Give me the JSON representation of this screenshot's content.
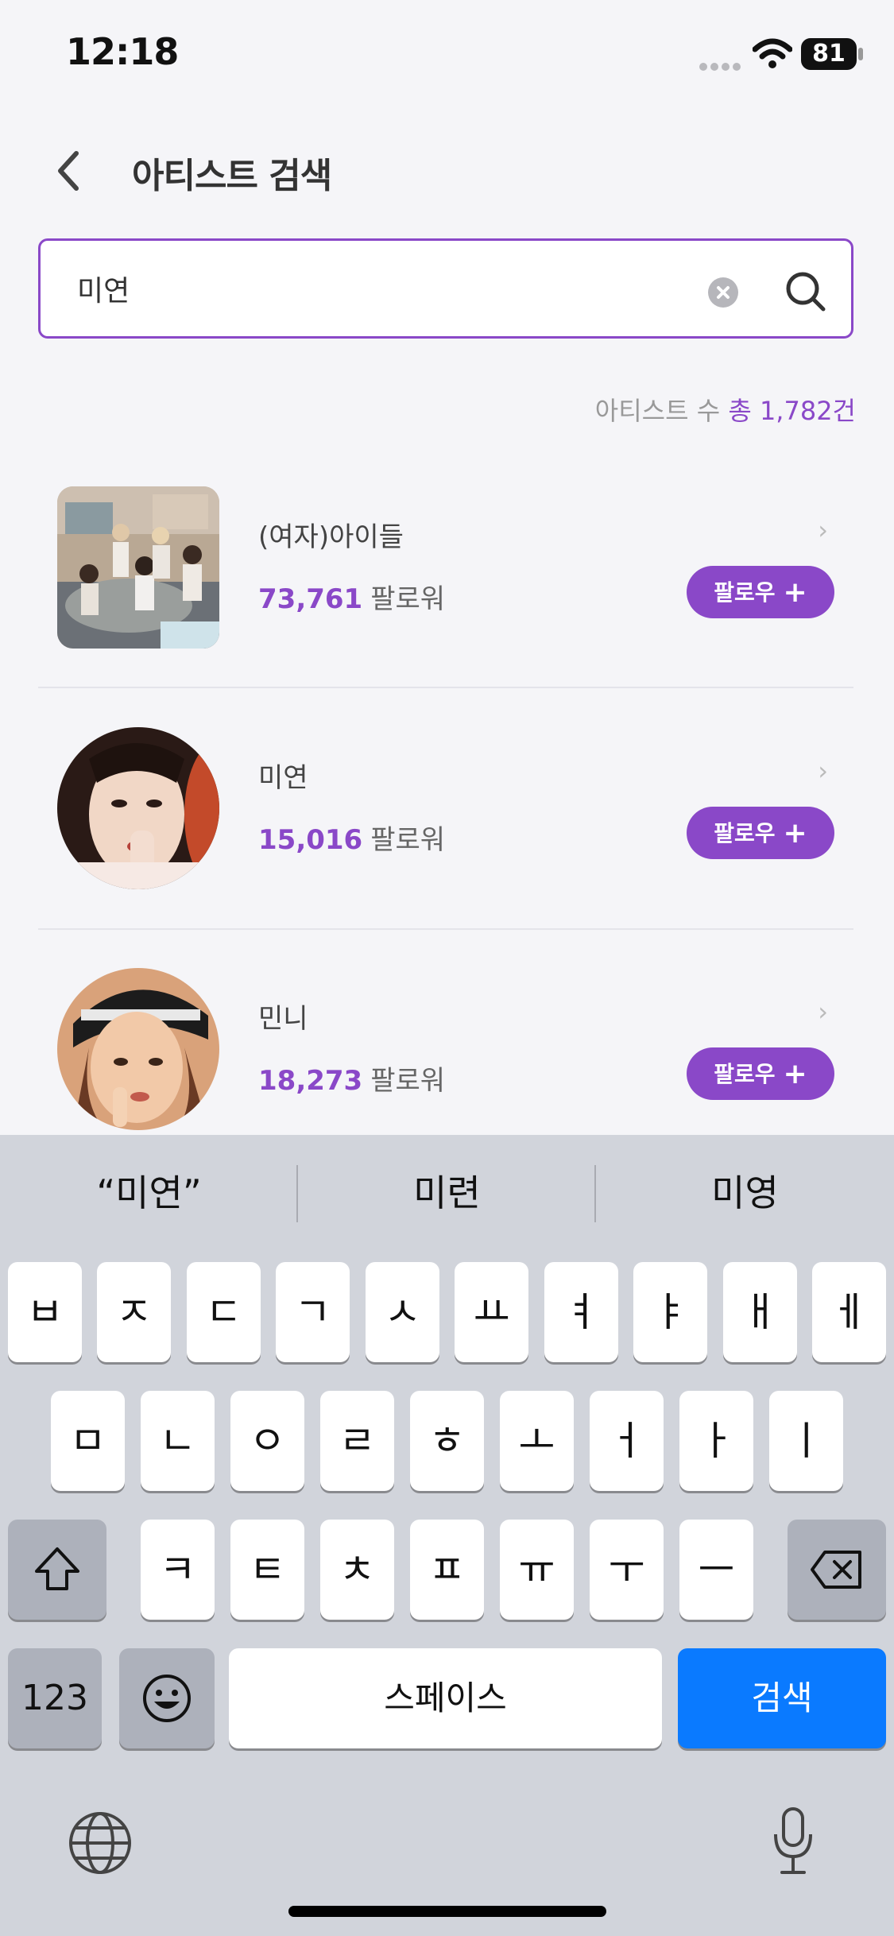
{
  "status_bar": {
    "time": "12:18",
    "battery": "81"
  },
  "header": {
    "title": "아티스트 검색"
  },
  "search": {
    "value": "미연",
    "placeholder": ""
  },
  "result_count": {
    "prefix": "아티스트 수",
    "total_label": "총 1,782건"
  },
  "results": [
    {
      "name": "(여자)아이들",
      "followers": "73,761",
      "followers_label": "팔로워",
      "follow_label": "팔로우"
    },
    {
      "name": "미연",
      "followers": "15,016",
      "followers_label": "팔로워",
      "follow_label": "팔로우"
    },
    {
      "name": "민니",
      "followers": "18,273",
      "followers_label": "팔로워",
      "follow_label": "팔로우"
    }
  ],
  "keyboard": {
    "suggestions": [
      "“미연”",
      "미련",
      "미영"
    ],
    "row1": [
      "ㅂ",
      "ㅈ",
      "ㄷ",
      "ㄱ",
      "ㅅ",
      "ㅛ",
      "ㅕ",
      "ㅑ",
      "ㅐ",
      "ㅔ"
    ],
    "row2": [
      "ㅁ",
      "ㄴ",
      "ㅇ",
      "ㄹ",
      "ㅎ",
      "ㅗ",
      "ㅓ",
      "ㅏ",
      "ㅣ"
    ],
    "row3": [
      "ㅋ",
      "ㅌ",
      "ㅊ",
      "ㅍ",
      "ㅠ",
      "ㅜ",
      "ㅡ"
    ],
    "numbers_key": "123",
    "space_key": "스페이스",
    "search_key": "검색"
  },
  "colors": {
    "accent": "#8a48c8",
    "keyboard_blue": "#0a7aff"
  }
}
